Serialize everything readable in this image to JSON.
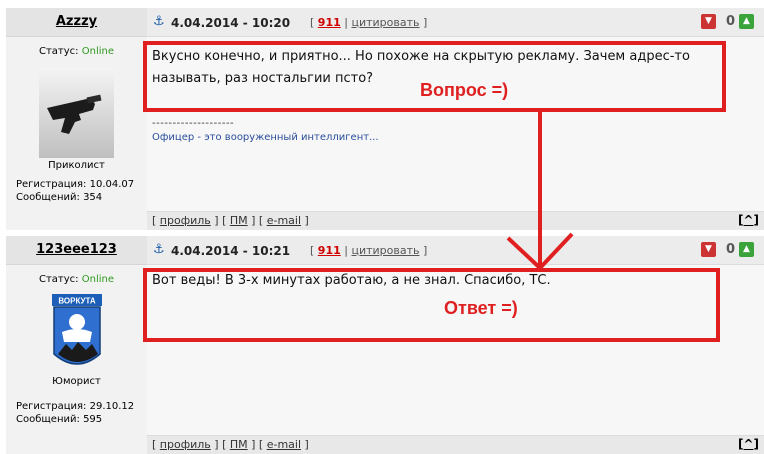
{
  "posts": [
    {
      "nick": "Azzzy",
      "status_label": "Статус:",
      "status_value": "Online",
      "rank": "Приколист",
      "reg_label": "Регистрация:",
      "reg_date": "10.04.07",
      "msgs_label": "Сообщений:",
      "msgs_count": "354",
      "date": "4.04.2014 - 10:20",
      "msg_number": "911",
      "quote_label": "цитировать",
      "votes": "0",
      "text_lines": [
        "Вкусно конечно, и приятно... Но похоже на скрытую рекламу. Зачем адрес-то",
        "называть, раз ностальгии псто?"
      ],
      "signature_sep": "--------------------",
      "signature": "Офицер - это вооруженный интеллигент..."
    },
    {
      "nick": "123eee123",
      "status_label": "Статус:",
      "status_value": "Online",
      "rank": "Юморист",
      "reg_label": "Регистрация:",
      "reg_date": "29.10.12",
      "msgs_label": "Сообщений:",
      "msgs_count": "595",
      "date": "4.04.2014 - 10:21",
      "msg_number": "911",
      "quote_label": "цитировать",
      "votes": "0",
      "text_lines": [
        "Вот веды! В 3-х минутах работаю, а не знал. Спасибо, ТС."
      ],
      "avatar_caption": "ВОРКУТА"
    }
  ],
  "footer_links": {
    "profile": "профиль",
    "pm": "ПМ",
    "email": "e-mail",
    "top": "^"
  },
  "annotations": {
    "question": "Вопрос =)",
    "answer": "Ответ =)",
    "color": "#e02020"
  }
}
